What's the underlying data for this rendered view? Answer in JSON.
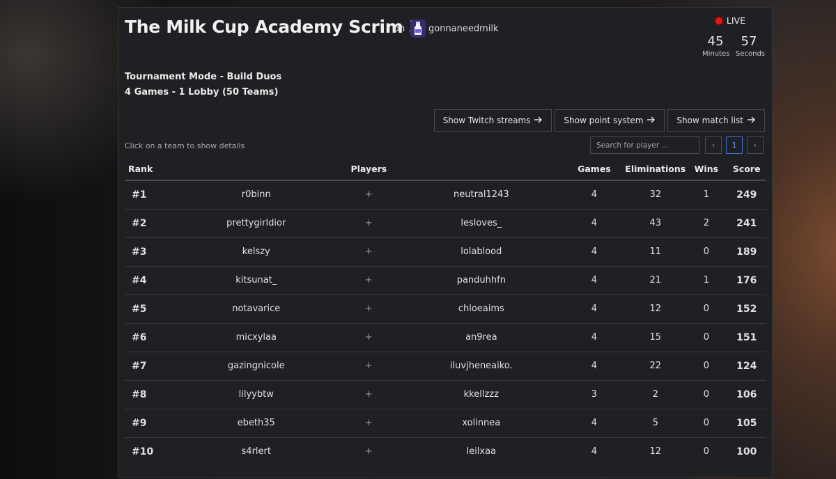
{
  "tournament": {
    "title": "The Milk Cup Academy Scrim 3",
    "on_label": "on",
    "host": "gonnaneedmilk",
    "host_icon": "milk-bottle-icon",
    "mode": "Tournament Mode - Build Duos",
    "format": "4 Games - 1 Lobby (50 Teams)"
  },
  "live": {
    "label": "LIVE",
    "color": "#e01818",
    "minutes": "45",
    "minutes_label": "Minutes",
    "seconds": "57",
    "seconds_label": "Seconds"
  },
  "buttons": {
    "twitch": "Show Twitch streams",
    "points": "Show point system",
    "matches": "Show match list"
  },
  "hint": "Click on a team to show details",
  "search": {
    "placeholder": "Search for player ..."
  },
  "pager": {
    "prev": "‹",
    "current": "1",
    "next": "›",
    "active_color": "#3a6fd8"
  },
  "table": {
    "headers": {
      "rank": "Rank",
      "players": "Players",
      "games": "Games",
      "eliminations": "Eliminations",
      "wins": "Wins",
      "score": "Score"
    },
    "rows": [
      {
        "rank": "#1",
        "p1": "r0binn",
        "plus": "+",
        "p2": "neutral1243",
        "games": "4",
        "elims": "32",
        "wins": "1",
        "score": "249"
      },
      {
        "rank": "#2",
        "p1": "prettygirldior",
        "plus": "+",
        "p2": "lesloves_",
        "games": "4",
        "elims": "43",
        "wins": "2",
        "score": "241"
      },
      {
        "rank": "#3",
        "p1": "kelszy",
        "plus": "+",
        "p2": "lolablood",
        "games": "4",
        "elims": "11",
        "wins": "0",
        "score": "189"
      },
      {
        "rank": "#4",
        "p1": "kitsunat_",
        "plus": "+",
        "p2": "panduhhfn",
        "games": "4",
        "elims": "21",
        "wins": "1",
        "score": "176"
      },
      {
        "rank": "#5",
        "p1": "notavarice",
        "plus": "+",
        "p2": "chloeaims",
        "games": "4",
        "elims": "12",
        "wins": "0",
        "score": "152"
      },
      {
        "rank": "#6",
        "p1": "micxylaa",
        "plus": "+",
        "p2": "an9rea",
        "games": "4",
        "elims": "15",
        "wins": "0",
        "score": "151"
      },
      {
        "rank": "#7",
        "p1": "gazingnicole",
        "plus": "+",
        "p2": "iluvjheneaiko.",
        "games": "4",
        "elims": "22",
        "wins": "0",
        "score": "124"
      },
      {
        "rank": "#8",
        "p1": "lilyybtw",
        "plus": "+",
        "p2": "kkellzzz",
        "games": "3",
        "elims": "2",
        "wins": "0",
        "score": "106"
      },
      {
        "rank": "#9",
        "p1": "ebeth35",
        "plus": "+",
        "p2": "xolinnea",
        "games": "4",
        "elims": "5",
        "wins": "0",
        "score": "105"
      },
      {
        "rank": "#10",
        "p1": "s4rlert",
        "plus": "+",
        "p2": "leilxaa",
        "games": "4",
        "elims": "12",
        "wins": "0",
        "score": "100"
      }
    ]
  }
}
